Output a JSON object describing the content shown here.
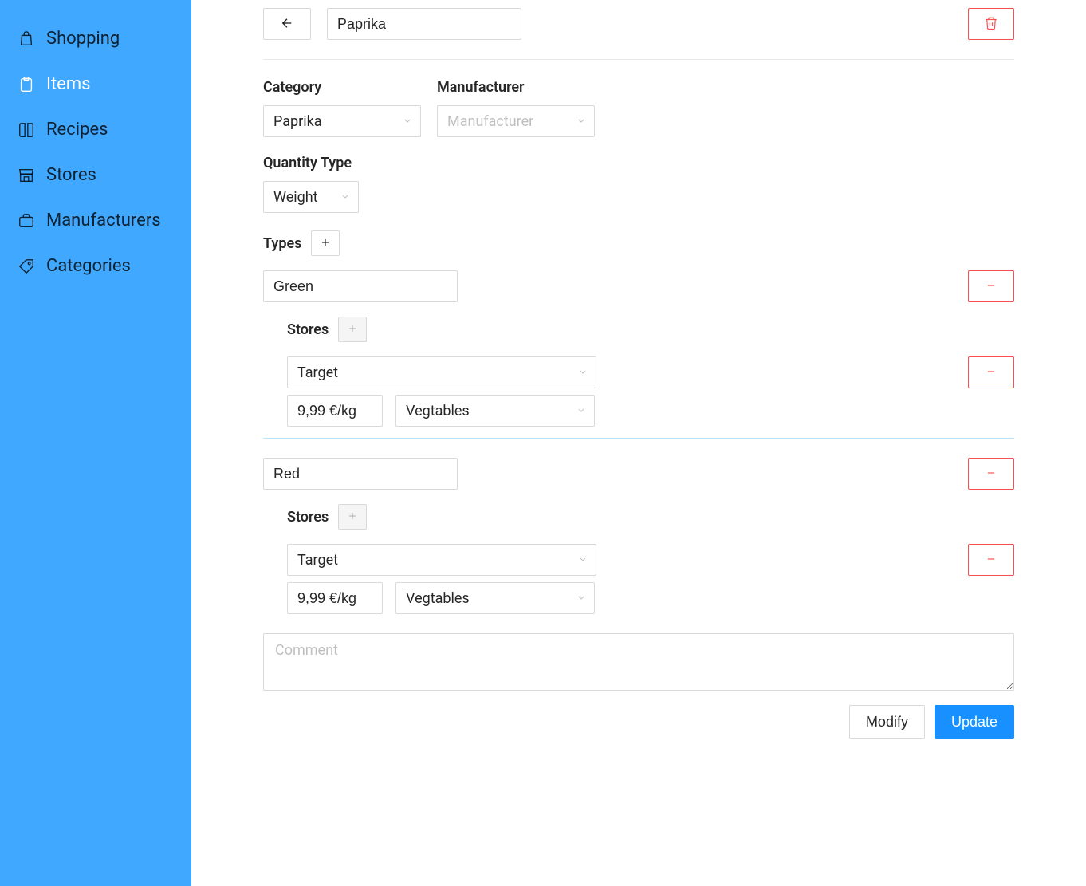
{
  "sidebar": {
    "items": [
      {
        "label": "Shopping"
      },
      {
        "label": "Items"
      },
      {
        "label": "Recipes"
      },
      {
        "label": "Stores"
      },
      {
        "label": "Manufacturers"
      },
      {
        "label": "Categories"
      }
    ]
  },
  "item": {
    "name": "Paprika",
    "category_label": "Category",
    "category_value": "Paprika",
    "manufacturer_label": "Manufacturer",
    "manufacturer_placeholder": "Manufacturer",
    "quantity_type_label": "Quantity Type",
    "quantity_type_value": "Weight",
    "types_label": "Types",
    "stores_label": "Stores",
    "types": [
      {
        "name": "Green",
        "stores": [
          {
            "store": "Target",
            "price": "9,99 €/kg",
            "section": "Vegtables"
          }
        ]
      },
      {
        "name": "Red",
        "stores": [
          {
            "store": "Target",
            "price": "9,99 €/kg",
            "section": "Vegtables"
          }
        ]
      }
    ],
    "comment_placeholder": "Comment"
  },
  "buttons": {
    "modify": "Modify",
    "update": "Update"
  }
}
